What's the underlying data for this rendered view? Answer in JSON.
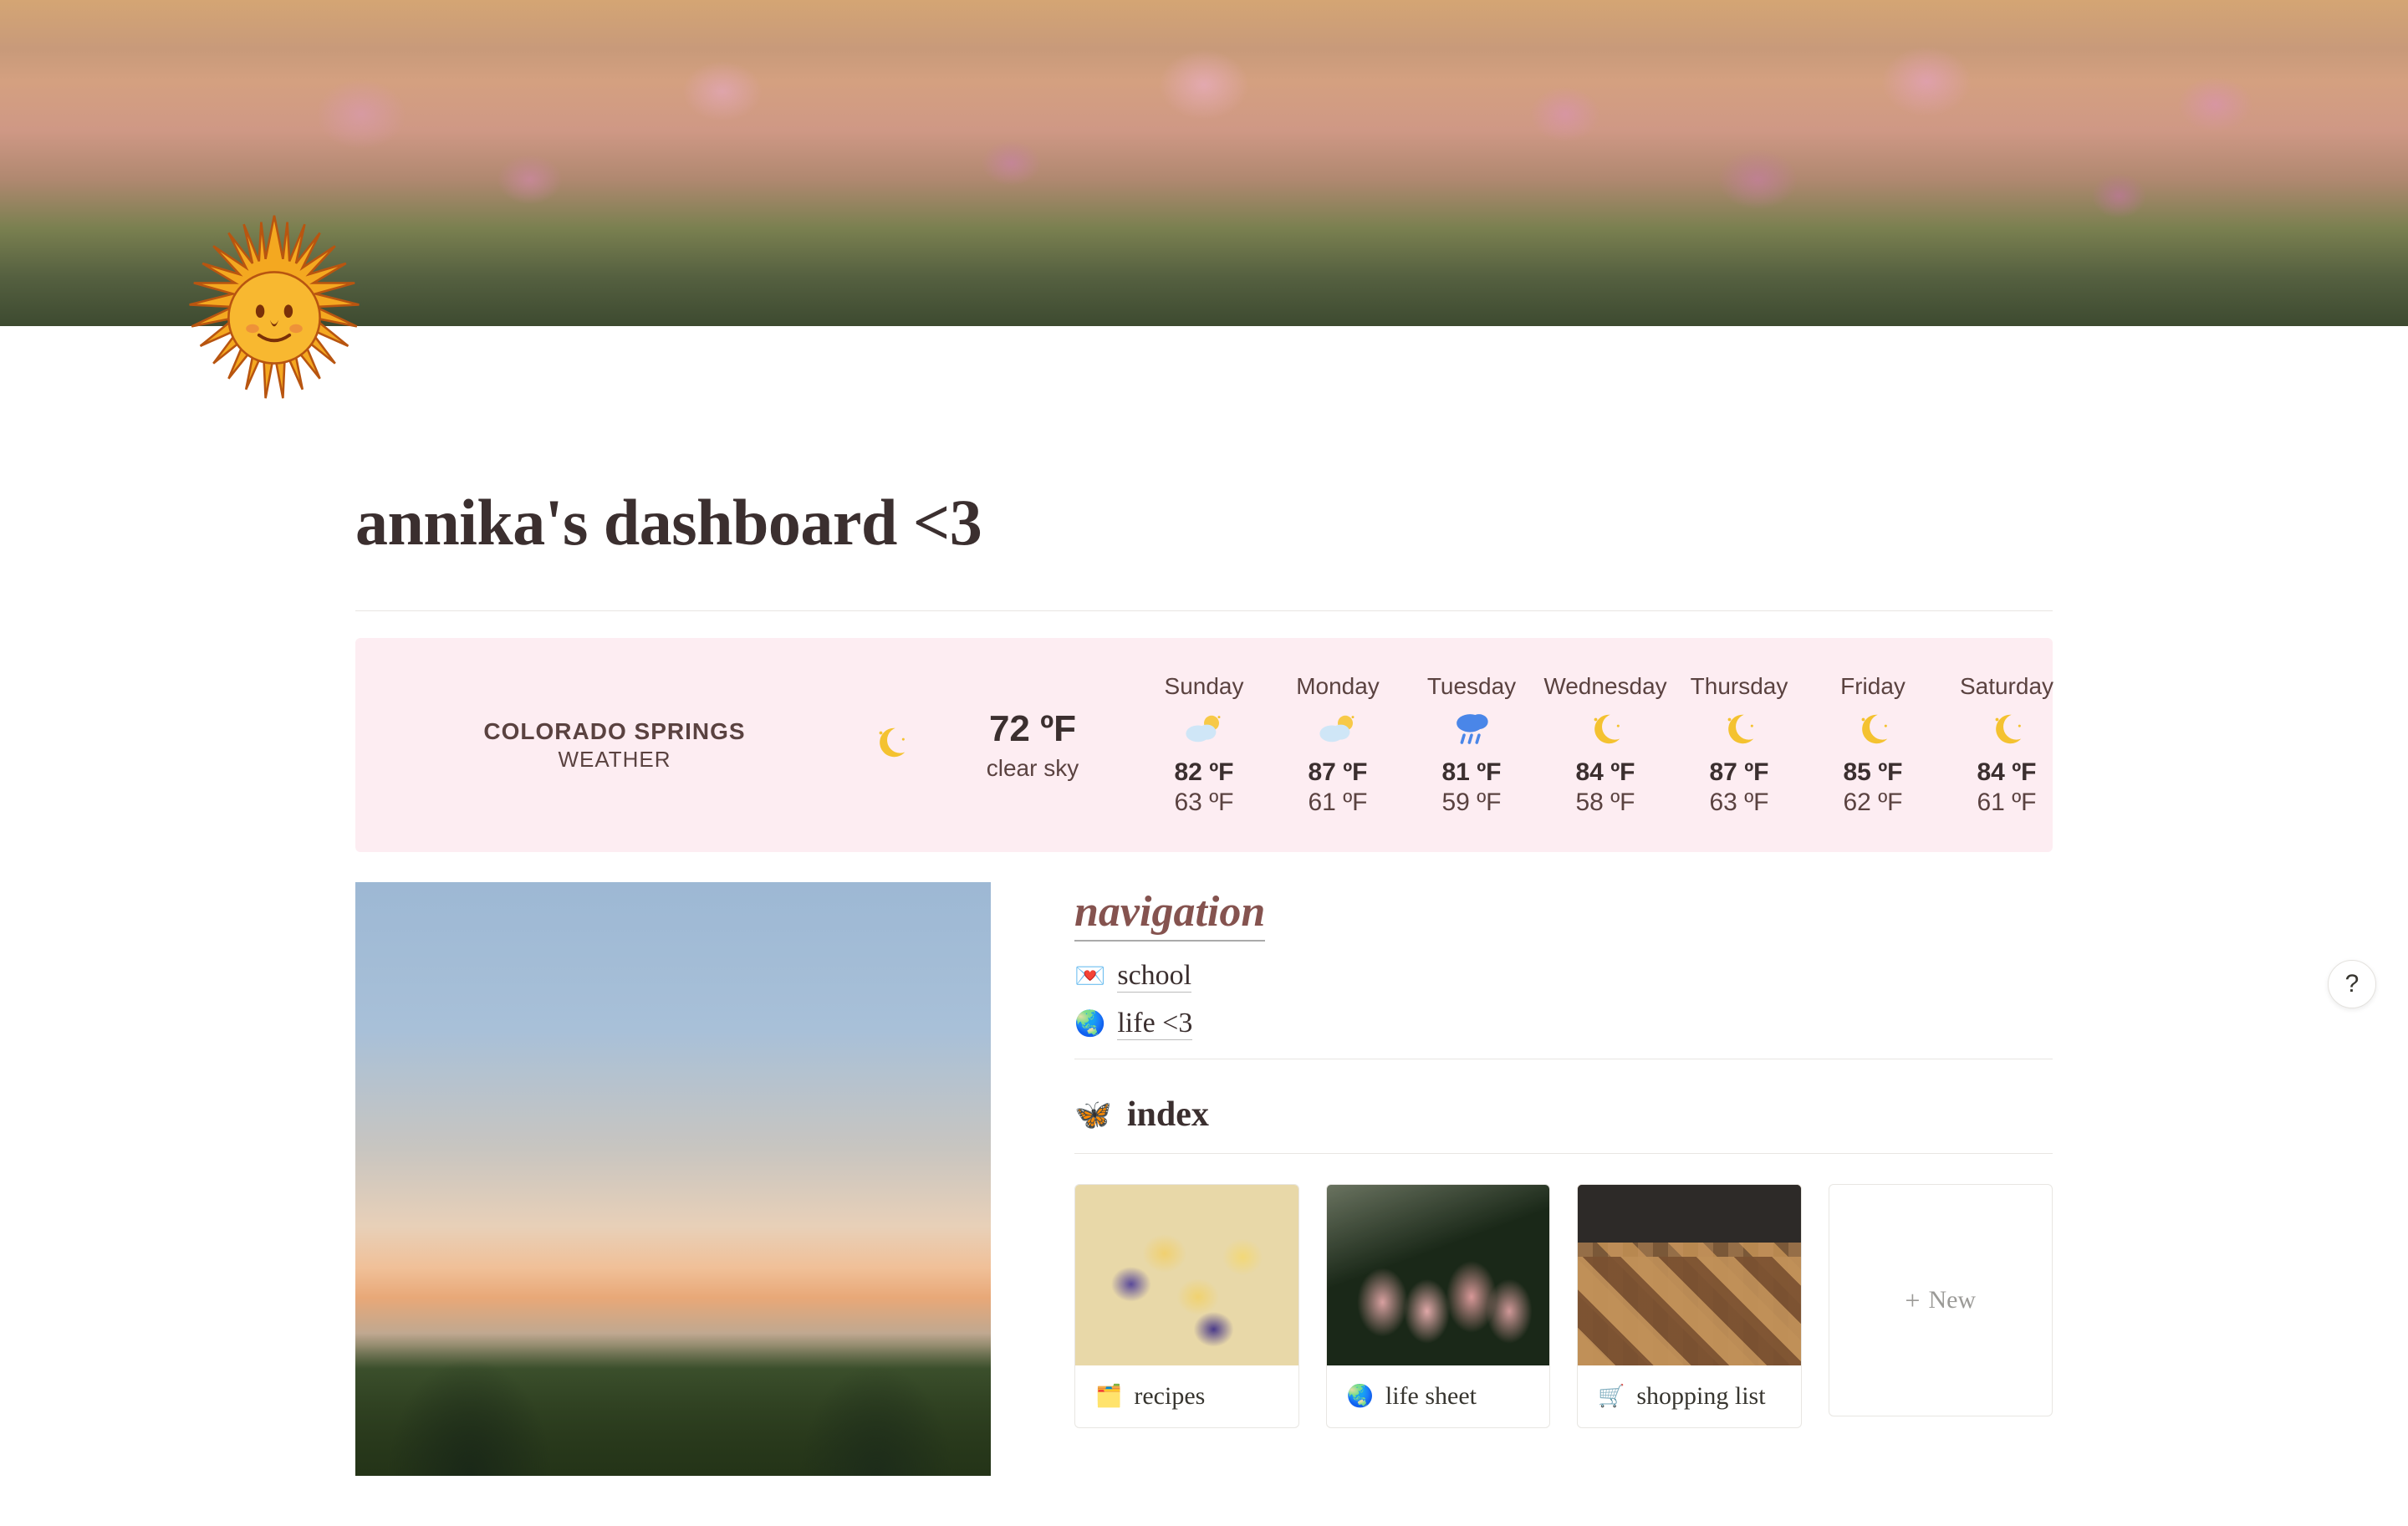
{
  "page": {
    "title": "annika's dashboard <3"
  },
  "weather": {
    "city": "COLORADO SPRINGS",
    "label": "WEATHER",
    "now": {
      "temp": "72 ºF",
      "condition": "clear sky",
      "icon": "moon"
    },
    "days": [
      {
        "name": "Sunday",
        "icon": "partly-cloudy",
        "hi": "82 ºF",
        "lo": "63 ºF"
      },
      {
        "name": "Monday",
        "icon": "partly-cloudy",
        "hi": "87 ºF",
        "lo": "61 ºF"
      },
      {
        "name": "Tuesday",
        "icon": "rain",
        "hi": "81 ºF",
        "lo": "59 ºF"
      },
      {
        "name": "Wednesday",
        "icon": "moon",
        "hi": "84 ºF",
        "lo": "58 ºF"
      },
      {
        "name": "Thursday",
        "icon": "moon",
        "hi": "87 ºF",
        "lo": "63 ºF"
      },
      {
        "name": "Friday",
        "icon": "moon",
        "hi": "85 ºF",
        "lo": "62 ºF"
      },
      {
        "name": "Saturday",
        "icon": "moon",
        "hi": "84 ºF",
        "lo": "61 ºF"
      }
    ]
  },
  "navigation": {
    "heading": "navigation",
    "links": [
      {
        "emoji": "💌",
        "label": "school"
      },
      {
        "emoji": "🌏",
        "label": "life <3"
      }
    ]
  },
  "index": {
    "emoji": "🦋",
    "heading": "index",
    "cards": [
      {
        "emoji": "🗂️",
        "label": "recipes",
        "imgClass": "img-recipes"
      },
      {
        "emoji": "🌏",
        "label": "life sheet",
        "imgClass": "img-life"
      },
      {
        "emoji": "🛒",
        "label": "shopping list",
        "imgClass": "img-shopping"
      }
    ],
    "new_label": "New"
  },
  "help": {
    "label": "?"
  }
}
